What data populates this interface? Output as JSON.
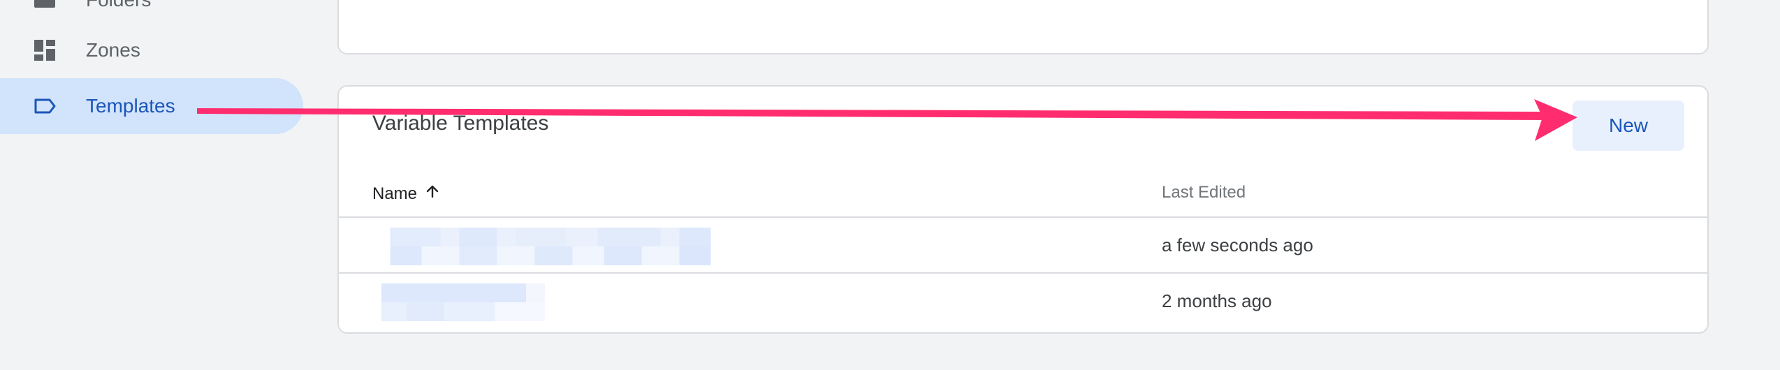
{
  "sidebar": {
    "items": [
      {
        "label": "Folders",
        "icon": "folder-icon"
      },
      {
        "label": "Zones",
        "icon": "zones-icon"
      },
      {
        "label": "Templates",
        "icon": "tag-icon",
        "selected": true
      }
    ]
  },
  "templates_card": {
    "title": "Variable Templates",
    "new_button_label": "New",
    "columns": {
      "name": "Name",
      "last_edited": "Last Edited"
    },
    "sort_icon": "arrow-up-icon",
    "rows": [
      {
        "name": "",
        "last_edited": "a few seconds ago"
      },
      {
        "name": "",
        "last_edited": "2 months ago"
      }
    ]
  },
  "colors": {
    "background": "#f1f3f4",
    "selected_nav_bg": "#d2e3fc",
    "accent_blue": "#1a56b8",
    "button_bg": "#e8f0fe",
    "annotation_arrow": "#ff2d6f"
  }
}
